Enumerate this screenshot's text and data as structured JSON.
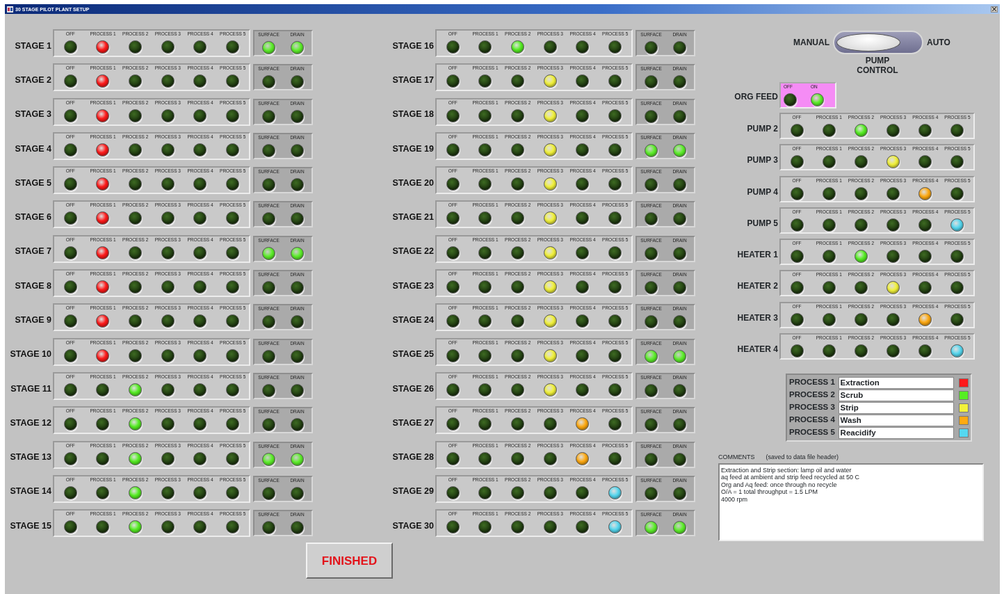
{
  "window": {
    "title": "30 STAGE PILOT PLANT SETUP"
  },
  "stage_columns": [
    {
      "stages": [
        {
          "label": "STAGE 1",
          "lamps": [
            {
              "label": "OFF",
              "on": false
            },
            {
              "label": "PROCESS 1",
              "on": true
            },
            {
              "label": "PROCESS 2",
              "on": false
            },
            {
              "label": "PROCESS 3",
              "on": false
            },
            {
              "label": "PROCESS 4",
              "on": false
            },
            {
              "label": "PROCESS 5",
              "on": false
            }
          ],
          "surface": {
            "label": "SURFACE",
            "on": true
          },
          "drain": {
            "label": "DRAIN",
            "on": true
          }
        },
        {
          "label": "STAGE 2",
          "lamps": [
            {
              "label": "OFF",
              "on": false
            },
            {
              "label": "PROCESS 1",
              "on": true
            },
            {
              "label": "PROCESS 2",
              "on": false
            },
            {
              "label": "PROCESS 3",
              "on": false
            },
            {
              "label": "PROCESS 4",
              "on": false
            },
            {
              "label": "PROCESS 5",
              "on": false
            }
          ],
          "surface": {
            "label": "SURFACE",
            "on": false
          },
          "drain": {
            "label": "DRAIN",
            "on": false
          }
        },
        {
          "label": "STAGE 3",
          "lamps": [
            {
              "label": "OFF",
              "on": false
            },
            {
              "label": "PROCESS 1",
              "on": true
            },
            {
              "label": "PROCESS 2",
              "on": false
            },
            {
              "label": "PROCESS 3",
              "on": false
            },
            {
              "label": "PROCESS 4",
              "on": false
            },
            {
              "label": "PROCESS 5",
              "on": false
            }
          ],
          "surface": {
            "label": "SURFACE",
            "on": false
          },
          "drain": {
            "label": "DRAIN",
            "on": false
          }
        },
        {
          "label": "STAGE 4",
          "lamps": [
            {
              "label": "OFF",
              "on": false
            },
            {
              "label": "PROCESS 1",
              "on": true
            },
            {
              "label": "PROCESS 2",
              "on": false
            },
            {
              "label": "PROCESS 3",
              "on": false
            },
            {
              "label": "PROCESS 4",
              "on": false
            },
            {
              "label": "PROCESS 5",
              "on": false
            }
          ],
          "surface": {
            "label": "SURFACE",
            "on": false
          },
          "drain": {
            "label": "DRAIN",
            "on": false
          }
        },
        {
          "label": "STAGE 5",
          "lamps": [
            {
              "label": "OFF",
              "on": false
            },
            {
              "label": "PROCESS 1",
              "on": true
            },
            {
              "label": "PROCESS 2",
              "on": false
            },
            {
              "label": "PROCESS 3",
              "on": false
            },
            {
              "label": "PROCESS 4",
              "on": false
            },
            {
              "label": "PROCESS 5",
              "on": false
            }
          ],
          "surface": {
            "label": "SURFACE",
            "on": false
          },
          "drain": {
            "label": "DRAIN",
            "on": false
          }
        },
        {
          "label": "STAGE 6",
          "lamps": [
            {
              "label": "OFF",
              "on": false
            },
            {
              "label": "PROCESS 1",
              "on": true
            },
            {
              "label": "PROCESS 2",
              "on": false
            },
            {
              "label": "PROCESS 3",
              "on": false
            },
            {
              "label": "PROCESS 4",
              "on": false
            },
            {
              "label": "PROCESS 5",
              "on": false
            }
          ],
          "surface": {
            "label": "SURFACE",
            "on": false
          },
          "drain": {
            "label": "DRAIN",
            "on": false
          }
        },
        {
          "label": "STAGE 7",
          "lamps": [
            {
              "label": "OFF",
              "on": false
            },
            {
              "label": "PROCESS 1",
              "on": true
            },
            {
              "label": "PROCESS 2",
              "on": false
            },
            {
              "label": "PROCESS 3",
              "on": false
            },
            {
              "label": "PROCESS 4",
              "on": false
            },
            {
              "label": "PROCESS 5",
              "on": false
            }
          ],
          "surface": {
            "label": "SURFACE",
            "on": true
          },
          "drain": {
            "label": "DRAIN",
            "on": true
          }
        },
        {
          "label": "STAGE 8",
          "lamps": [
            {
              "label": "OFF",
              "on": false
            },
            {
              "label": "PROCESS 1",
              "on": true
            },
            {
              "label": "PROCESS 2",
              "on": false
            },
            {
              "label": "PROCESS 3",
              "on": false
            },
            {
              "label": "PROCESS 4",
              "on": false
            },
            {
              "label": "PROCESS 5",
              "on": false
            }
          ],
          "surface": {
            "label": "SURFACE",
            "on": false
          },
          "drain": {
            "label": "DRAIN",
            "on": false
          }
        },
        {
          "label": "STAGE 9",
          "lamps": [
            {
              "label": "OFF",
              "on": false
            },
            {
              "label": "PROCESS 1",
              "on": true
            },
            {
              "label": "PROCESS 2",
              "on": false
            },
            {
              "label": "PROCESS 3",
              "on": false
            },
            {
              "label": "PROCESS 4",
              "on": false
            },
            {
              "label": "PROCESS 5",
              "on": false
            }
          ],
          "surface": {
            "label": "SURFACE",
            "on": false
          },
          "drain": {
            "label": "DRAIN",
            "on": false
          }
        },
        {
          "label": "STAGE 10",
          "lamps": [
            {
              "label": "OFF",
              "on": false
            },
            {
              "label": "PROCESS 1",
              "on": true
            },
            {
              "label": "PROCESS 2",
              "on": false
            },
            {
              "label": "PROCESS 3",
              "on": false
            },
            {
              "label": "PROCESS 4",
              "on": false
            },
            {
              "label": "PROCESS 5",
              "on": false
            }
          ],
          "surface": {
            "label": "SURFACE",
            "on": false
          },
          "drain": {
            "label": "DRAIN",
            "on": false
          }
        },
        {
          "label": "STAGE 11",
          "lamps": [
            {
              "label": "OFF",
              "on": false
            },
            {
              "label": "PROCESS 1",
              "on": false
            },
            {
              "label": "PROCESS 2",
              "on": true
            },
            {
              "label": "PROCESS 3",
              "on": false
            },
            {
              "label": "PROCESS 4",
              "on": false
            },
            {
              "label": "PROCESS 5",
              "on": false
            }
          ],
          "surface": {
            "label": "SURFACE",
            "on": false
          },
          "drain": {
            "label": "DRAIN",
            "on": false
          }
        },
        {
          "label": "STAGE 12",
          "lamps": [
            {
              "label": "OFF",
              "on": false
            },
            {
              "label": "PROCESS 1",
              "on": false
            },
            {
              "label": "PROCESS 2",
              "on": true
            },
            {
              "label": "PROCESS 3",
              "on": false
            },
            {
              "label": "PROCESS 4",
              "on": false
            },
            {
              "label": "PROCESS 5",
              "on": false
            }
          ],
          "surface": {
            "label": "SURFACE",
            "on": false
          },
          "drain": {
            "label": "DRAIN",
            "on": false
          }
        },
        {
          "label": "STAGE 13",
          "lamps": [
            {
              "label": "OFF",
              "on": false
            },
            {
              "label": "PROCESS 1",
              "on": false
            },
            {
              "label": "PROCESS 2",
              "on": true
            },
            {
              "label": "PROCESS 3",
              "on": false
            },
            {
              "label": "PROCESS 4",
              "on": false
            },
            {
              "label": "PROCESS 5",
              "on": false
            }
          ],
          "surface": {
            "label": "SURFACE",
            "on": true
          },
          "drain": {
            "label": "DRAIN",
            "on": true
          }
        },
        {
          "label": "STAGE 14",
          "lamps": [
            {
              "label": "OFF",
              "on": false
            },
            {
              "label": "PROCESS 1",
              "on": false
            },
            {
              "label": "PROCESS 2",
              "on": true
            },
            {
              "label": "PROCESS 3",
              "on": false
            },
            {
              "label": "PROCESS 4",
              "on": false
            },
            {
              "label": "PROCESS 5",
              "on": false
            }
          ],
          "surface": {
            "label": "SURFACE",
            "on": false
          },
          "drain": {
            "label": "DRAIN",
            "on": false
          }
        },
        {
          "label": "STAGE 15",
          "lamps": [
            {
              "label": "OFF",
              "on": false
            },
            {
              "label": "PROCESS 1",
              "on": false
            },
            {
              "label": "PROCESS 2",
              "on": true
            },
            {
              "label": "PROCESS 3",
              "on": false
            },
            {
              "label": "PROCESS 4",
              "on": false
            },
            {
              "label": "PROCESS 5",
              "on": false
            }
          ],
          "surface": {
            "label": "SURFACE",
            "on": false
          },
          "drain": {
            "label": "DRAIN",
            "on": false
          }
        }
      ]
    },
    {
      "stages": [
        {
          "label": "STAGE 16",
          "lamps": [
            {
              "label": "OFF",
              "on": false
            },
            {
              "label": "PROCESS 1",
              "on": false
            },
            {
              "label": "PROCESS 2",
              "on": true
            },
            {
              "label": "PROCESS 3",
              "on": false
            },
            {
              "label": "PROCESS 4",
              "on": false
            },
            {
              "label": "PROCESS 5",
              "on": false
            }
          ],
          "surface": {
            "label": "SURFACE",
            "on": false
          },
          "drain": {
            "label": "DRAIN",
            "on": false
          }
        },
        {
          "label": "STAGE 17",
          "lamps": [
            {
              "label": "OFF",
              "on": false
            },
            {
              "label": "PROCESS 1",
              "on": false
            },
            {
              "label": "PROCESS 2",
              "on": false
            },
            {
              "label": "PROCESS 3",
              "on": true
            },
            {
              "label": "PROCESS 4",
              "on": false
            },
            {
              "label": "PROCESS 5",
              "on": false
            }
          ],
          "surface": {
            "label": "SURFACE",
            "on": false
          },
          "drain": {
            "label": "DRAIN",
            "on": false
          }
        },
        {
          "label": "STAGE 18",
          "lamps": [
            {
              "label": "OFF",
              "on": false
            },
            {
              "label": "PROCESS 1",
              "on": false
            },
            {
              "label": "PROCESS 2",
              "on": false
            },
            {
              "label": "PROCESS 3",
              "on": true
            },
            {
              "label": "PROCESS 4",
              "on": false
            },
            {
              "label": "PROCESS 5",
              "on": false
            }
          ],
          "surface": {
            "label": "SURFACE",
            "on": false
          },
          "drain": {
            "label": "DRAIN",
            "on": false
          }
        },
        {
          "label": "STAGE 19",
          "lamps": [
            {
              "label": "OFF",
              "on": false
            },
            {
              "label": "PROCESS 1",
              "on": false
            },
            {
              "label": "PROCESS 2",
              "on": false
            },
            {
              "label": "PROCESS 3",
              "on": true
            },
            {
              "label": "PROCESS 4",
              "on": false
            },
            {
              "label": "PROCESS 5",
              "on": false
            }
          ],
          "surface": {
            "label": "SURFACE",
            "on": true
          },
          "drain": {
            "label": "DRAIN",
            "on": true
          }
        },
        {
          "label": "STAGE 20",
          "lamps": [
            {
              "label": "OFF",
              "on": false
            },
            {
              "label": "PROCESS 1",
              "on": false
            },
            {
              "label": "PROCESS 2",
              "on": false
            },
            {
              "label": "PROCESS 3",
              "on": true
            },
            {
              "label": "PROCESS 4",
              "on": false
            },
            {
              "label": "PROCESS 5",
              "on": false
            }
          ],
          "surface": {
            "label": "SURFACE",
            "on": false
          },
          "drain": {
            "label": "DRAIN",
            "on": false
          }
        },
        {
          "label": "STAGE 21",
          "lamps": [
            {
              "label": "OFF",
              "on": false
            },
            {
              "label": "PROCESS 1",
              "on": false
            },
            {
              "label": "PROCESS 2",
              "on": false
            },
            {
              "label": "PROCESS 3",
              "on": true
            },
            {
              "label": "PROCESS 4",
              "on": false
            },
            {
              "label": "PROCESS 5",
              "on": false
            }
          ],
          "surface": {
            "label": "SURFACE",
            "on": false
          },
          "drain": {
            "label": "DRAIN",
            "on": false
          }
        },
        {
          "label": "STAGE 22",
          "lamps": [
            {
              "label": "OFF",
              "on": false
            },
            {
              "label": "PROCESS 1",
              "on": false
            },
            {
              "label": "PROCESS 2",
              "on": false
            },
            {
              "label": "PROCESS 3",
              "on": true
            },
            {
              "label": "PROCESS 4",
              "on": false
            },
            {
              "label": "PROCESS 5",
              "on": false
            }
          ],
          "surface": {
            "label": "SURFACE",
            "on": false
          },
          "drain": {
            "label": "DRAIN",
            "on": false
          }
        },
        {
          "label": "STAGE 23",
          "lamps": [
            {
              "label": "OFF",
              "on": false
            },
            {
              "label": "PROCESS 1",
              "on": false
            },
            {
              "label": "PROCESS 2",
              "on": false
            },
            {
              "label": "PROCESS 3",
              "on": true
            },
            {
              "label": "PROCESS 4",
              "on": false
            },
            {
              "label": "PROCESS 5",
              "on": false
            }
          ],
          "surface": {
            "label": "SURFACE",
            "on": false
          },
          "drain": {
            "label": "DRAIN",
            "on": false
          }
        },
        {
          "label": "STAGE 24",
          "lamps": [
            {
              "label": "OFF",
              "on": false
            },
            {
              "label": "PROCESS 1",
              "on": false
            },
            {
              "label": "PROCESS 2",
              "on": false
            },
            {
              "label": "PROCESS 3",
              "on": true
            },
            {
              "label": "PROCESS 4",
              "on": false
            },
            {
              "label": "PROCESS 5",
              "on": false
            }
          ],
          "surface": {
            "label": "SURFACE",
            "on": false
          },
          "drain": {
            "label": "DRAIN",
            "on": false
          }
        },
        {
          "label": "STAGE 25",
          "lamps": [
            {
              "label": "OFF",
              "on": false
            },
            {
              "label": "PROCESS 1",
              "on": false
            },
            {
              "label": "PROCESS 2",
              "on": false
            },
            {
              "label": "PROCESS 3",
              "on": true
            },
            {
              "label": "PROCESS 4",
              "on": false
            },
            {
              "label": "PROCESS 5",
              "on": false
            }
          ],
          "surface": {
            "label": "SURFACE",
            "on": true
          },
          "drain": {
            "label": "DRAIN",
            "on": true
          }
        },
        {
          "label": "STAGE 26",
          "lamps": [
            {
              "label": "OFF",
              "on": false
            },
            {
              "label": "PROCESS 1",
              "on": false
            },
            {
              "label": "PROCESS 2",
              "on": false
            },
            {
              "label": "PROCESS 3",
              "on": true
            },
            {
              "label": "PROCESS 4",
              "on": false
            },
            {
              "label": "PROCESS 5",
              "on": false
            }
          ],
          "surface": {
            "label": "SURFACE",
            "on": false
          },
          "drain": {
            "label": "DRAIN",
            "on": false
          }
        },
        {
          "label": "STAGE 27",
          "lamps": [
            {
              "label": "OFF",
              "on": false
            },
            {
              "label": "PROCESS 1",
              "on": false
            },
            {
              "label": "PROCESS 2",
              "on": false
            },
            {
              "label": "PROCESS 3",
              "on": false
            },
            {
              "label": "PROCESS 4",
              "on": true
            },
            {
              "label": "PROCESS 5",
              "on": false
            }
          ],
          "surface": {
            "label": "SURFACE",
            "on": false
          },
          "drain": {
            "label": "DRAIN",
            "on": false
          }
        },
        {
          "label": "STAGE 28",
          "lamps": [
            {
              "label": "OFF",
              "on": false
            },
            {
              "label": "PROCESS 1",
              "on": false
            },
            {
              "label": "PROCESS 2",
              "on": false
            },
            {
              "label": "PROCESS 3",
              "on": false
            },
            {
              "label": "PROCESS 4",
              "on": true
            },
            {
              "label": "PROCESS 5",
              "on": false
            }
          ],
          "surface": {
            "label": "SURFACE",
            "on": false
          },
          "drain": {
            "label": "DRAIN",
            "on": false
          }
        },
        {
          "label": "STAGE 29",
          "lamps": [
            {
              "label": "OFF",
              "on": false
            },
            {
              "label": "PROCESS 1",
              "on": false
            },
            {
              "label": "PROCESS 2",
              "on": false
            },
            {
              "label": "PROCESS 3",
              "on": false
            },
            {
              "label": "PROCESS 4",
              "on": false
            },
            {
              "label": "PROCESS 5",
              "on": true
            }
          ],
          "surface": {
            "label": "SURFACE",
            "on": false
          },
          "drain": {
            "label": "DRAIN",
            "on": false
          }
        },
        {
          "label": "STAGE 30",
          "lamps": [
            {
              "label": "OFF",
              "on": false
            },
            {
              "label": "PROCESS 1",
              "on": false
            },
            {
              "label": "PROCESS 2",
              "on": false
            },
            {
              "label": "PROCESS 3",
              "on": false
            },
            {
              "label": "PROCESS 4",
              "on": false
            },
            {
              "label": "PROCESS 5",
              "on": true
            }
          ],
          "surface": {
            "label": "SURFACE",
            "on": true
          },
          "drain": {
            "label": "DRAIN",
            "on": true
          }
        }
      ]
    }
  ],
  "finish_button": "FINISHED",
  "pump_control": {
    "left_label": "MANUAL",
    "right_label": "AUTO",
    "label": "PUMP CONTROL",
    "auto": false
  },
  "org_feed": {
    "label": "ORG FEED",
    "lamps": [
      {
        "label": "OFF",
        "on": false
      },
      {
        "label": "ON",
        "on": true
      }
    ]
  },
  "pumps": [
    {
      "label": "PUMP 2",
      "lamps": [
        {
          "label": "OFF",
          "on": false
        },
        {
          "label": "PROCESS 1",
          "on": false
        },
        {
          "label": "PROCESS 2",
          "on": true
        },
        {
          "label": "PROCESS 3",
          "on": false
        },
        {
          "label": "PROCESS 4",
          "on": false
        },
        {
          "label": "PROCESS 5",
          "on": false
        }
      ]
    },
    {
      "label": "PUMP 3",
      "lamps": [
        {
          "label": "OFF",
          "on": false
        },
        {
          "label": "PROCESS 1",
          "on": false
        },
        {
          "label": "PROCESS 2",
          "on": false
        },
        {
          "label": "PROCESS 3",
          "on": true
        },
        {
          "label": "PROCESS 4",
          "on": false
        },
        {
          "label": "PROCESS 5",
          "on": false
        }
      ]
    },
    {
      "label": "PUMP 4",
      "lamps": [
        {
          "label": "OFF",
          "on": false
        },
        {
          "label": "PROCESS 1",
          "on": false
        },
        {
          "label": "PROCESS 2",
          "on": false
        },
        {
          "label": "PROCESS 3",
          "on": false
        },
        {
          "label": "PROCESS 4",
          "on": true
        },
        {
          "label": "PROCESS 5",
          "on": false
        }
      ]
    },
    {
      "label": "PUMP 5",
      "lamps": [
        {
          "label": "OFF",
          "on": false
        },
        {
          "label": "PROCESS 1",
          "on": false
        },
        {
          "label": "PROCESS 2",
          "on": false
        },
        {
          "label": "PROCESS 3",
          "on": false
        },
        {
          "label": "PROCESS 4",
          "on": false
        },
        {
          "label": "PROCESS 5",
          "on": true
        }
      ]
    },
    {
      "label": "HEATER 1",
      "lamps": [
        {
          "label": "OFF",
          "on": false
        },
        {
          "label": "PROCESS 1",
          "on": false
        },
        {
          "label": "PROCESS 2",
          "on": true
        },
        {
          "label": "PROCESS 3",
          "on": false
        },
        {
          "label": "PROCESS 4",
          "on": false
        },
        {
          "label": "PROCESS 5",
          "on": false
        }
      ]
    },
    {
      "label": "HEATER 2",
      "lamps": [
        {
          "label": "OFF",
          "on": false
        },
        {
          "label": "PROCESS 1",
          "on": false
        },
        {
          "label": "PROCESS 2",
          "on": false
        },
        {
          "label": "PROCESS 3",
          "on": true
        },
        {
          "label": "PROCESS 4",
          "on": false
        },
        {
          "label": "PROCESS 5",
          "on": false
        }
      ]
    },
    {
      "label": "HEATER 3",
      "lamps": [
        {
          "label": "OFF",
          "on": false
        },
        {
          "label": "PROCESS 1",
          "on": false
        },
        {
          "label": "PROCESS 2",
          "on": false
        },
        {
          "label": "PROCESS 3",
          "on": false
        },
        {
          "label": "PROCESS 4",
          "on": true
        },
        {
          "label": "PROCESS 5",
          "on": false
        }
      ]
    },
    {
      "label": "HEATER 4",
      "lamps": [
        {
          "label": "OFF",
          "on": false
        },
        {
          "label": "PROCESS 1",
          "on": false
        },
        {
          "label": "PROCESS 2",
          "on": false
        },
        {
          "label": "PROCESS 3",
          "on": false
        },
        {
          "label": "PROCESS 4",
          "on": false
        },
        {
          "label": "PROCESS 5",
          "on": true
        }
      ]
    }
  ],
  "legend": [
    {
      "label": "PROCESS 1",
      "name": "Extraction",
      "color": "#ff1a1a"
    },
    {
      "label": "PROCESS 2",
      "name": "Scrub",
      "color": "#55ee22"
    },
    {
      "label": "PROCESS 3",
      "name": "Strip",
      "color": "#f2f23a"
    },
    {
      "label": "PROCESS 4",
      "name": "Wash",
      "color": "#ffaa11"
    },
    {
      "label": "PROCESS 5",
      "name": "Reacidify",
      "color": "#55d8f0"
    }
  ],
  "comments": {
    "label": "COMMENTS",
    "note": "(saved to data file header)",
    "lines": [
      "Extraction and Strip section: lamp oil and water",
      "aq feed at ambient and strip feed recycled at 50 C",
      "Org and Aq feed: once through no recycle",
      "O/A = 1 total throughput = 1.5 LPM",
      "4000 rpm"
    ]
  }
}
